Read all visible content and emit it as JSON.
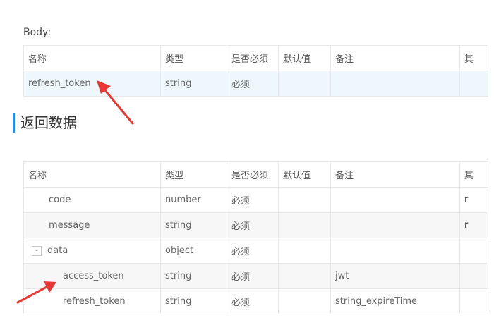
{
  "body_section": {
    "label": "Body:",
    "headers": [
      "名称",
      "类型",
      "是否必须",
      "默认值",
      "备注",
      "其"
    ],
    "rows": [
      {
        "name": "refresh_token",
        "type": "string",
        "required": "必须",
        "default": "",
        "note": "",
        "extra": ""
      }
    ]
  },
  "return_section": {
    "heading": "返回数据",
    "headers": [
      "名称",
      "类型",
      "是否必须",
      "默认值",
      "备注",
      "其"
    ],
    "rows": [
      {
        "name": "code",
        "type": "number",
        "required": "必须",
        "default": "",
        "note": "",
        "extra": "r"
      },
      {
        "name": "message",
        "type": "string",
        "required": "必须",
        "default": "",
        "note": "",
        "extra": "r"
      },
      {
        "toggle": "-",
        "name": "data",
        "type": "object",
        "required": "必须",
        "default": "",
        "note": "",
        "extra": ""
      },
      {
        "name": "access_token",
        "type": "string",
        "required": "必须",
        "default": "",
        "note": "jwt",
        "extra": ""
      },
      {
        "name": "refresh_token",
        "type": "string",
        "required": "必须",
        "default": "",
        "note": "string_expireTime",
        "extra": ""
      }
    ]
  },
  "colors": {
    "accent": "#2d8cd6",
    "highlight_row": "#eef8fc",
    "alt_row": "#f7f7f7",
    "arrow": "#e53935"
  }
}
